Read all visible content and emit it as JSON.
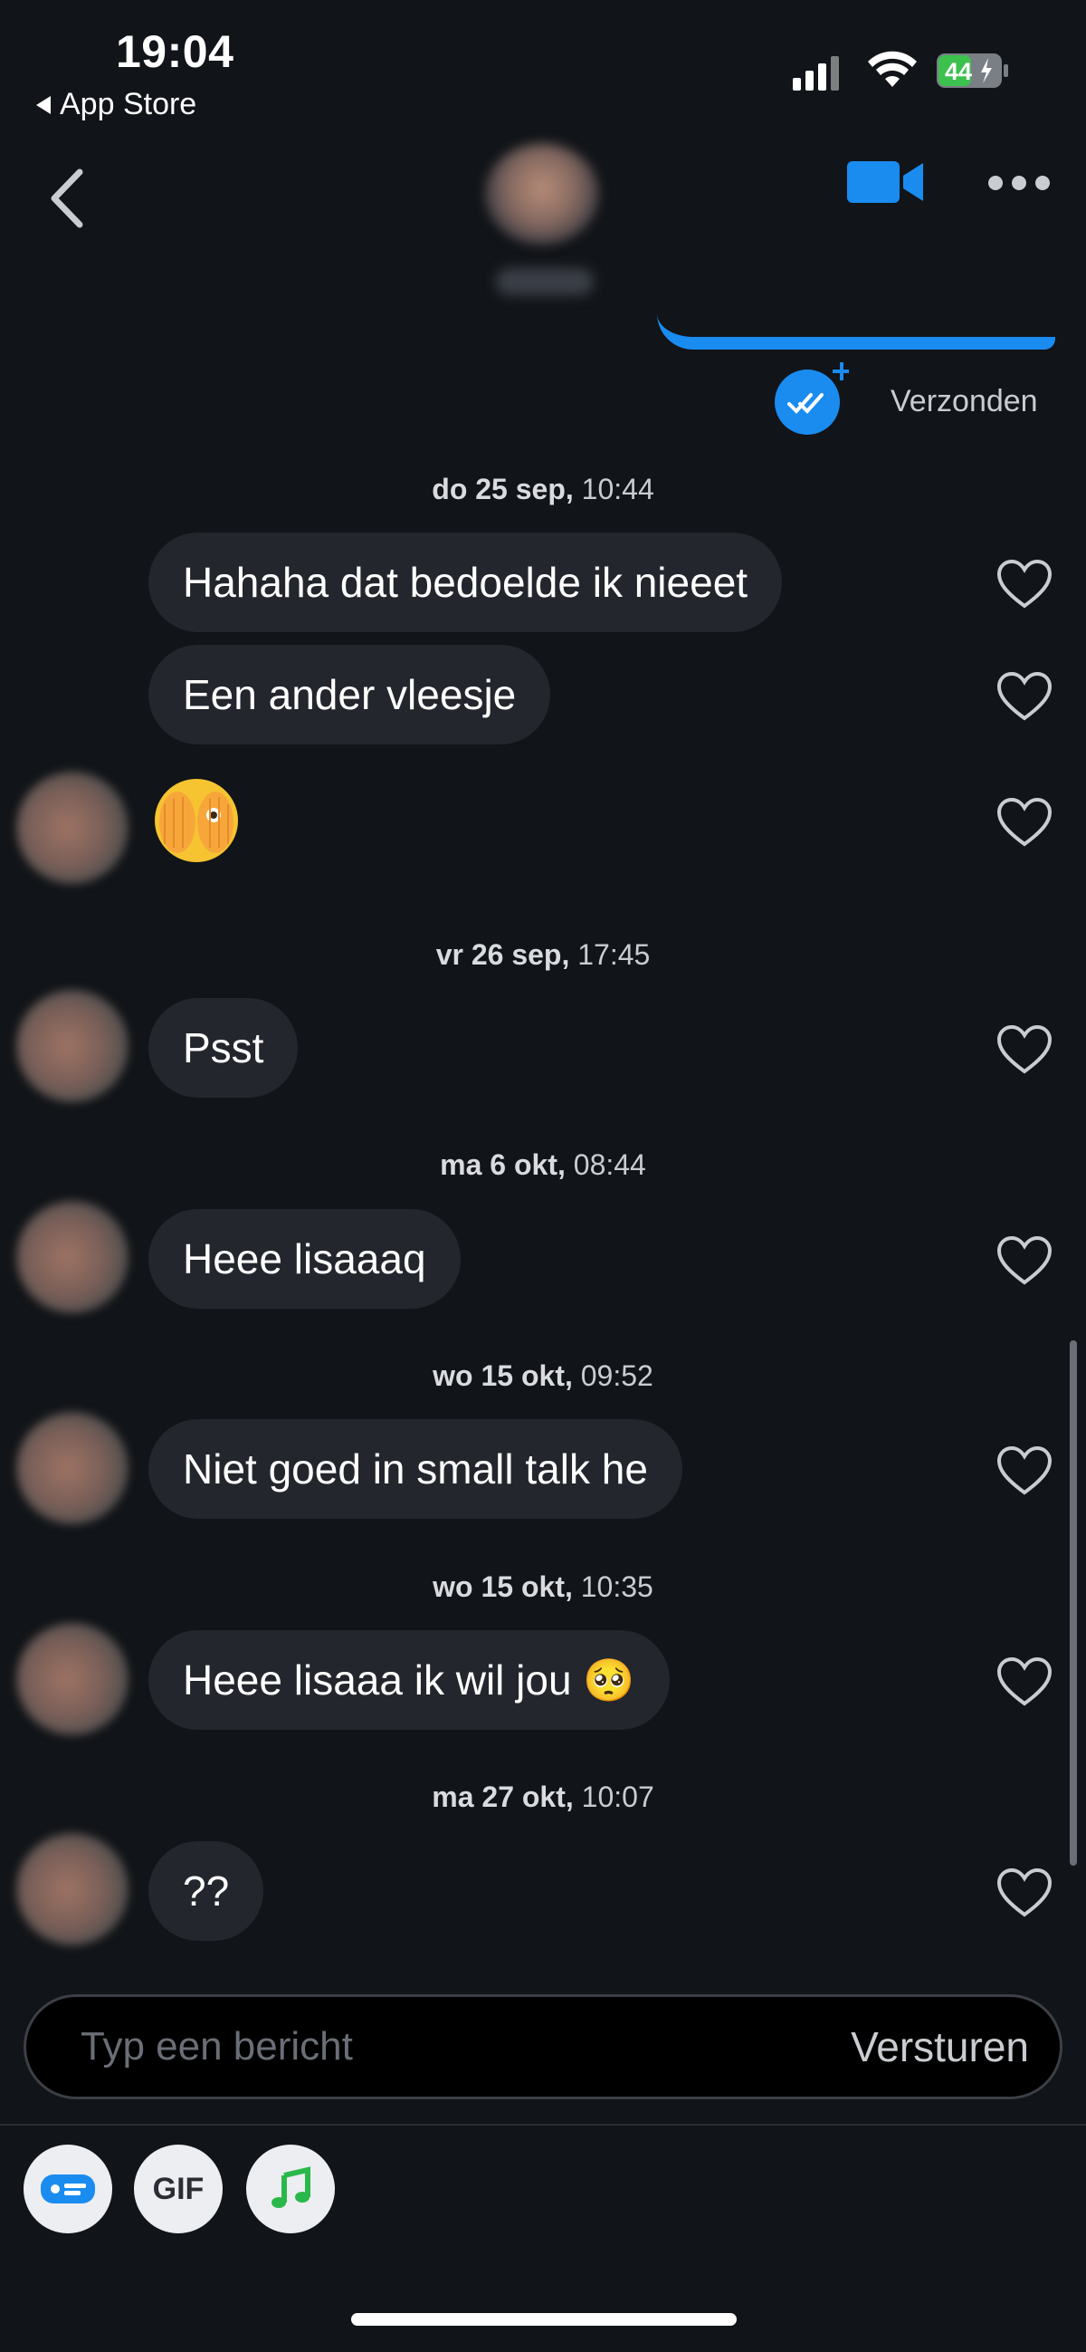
{
  "status_bar": {
    "time": "19:04",
    "back_app": "App Store",
    "battery": "44"
  },
  "header": {
    "back_icon": "chevron-left-icon",
    "video_icon": "video-camera-icon",
    "more_icon": "ellipsis-icon"
  },
  "sent_status": "Verzonden",
  "messages": [
    {
      "date_day": "do 25 sep,",
      "date_time": "10:44"
    },
    {
      "text": "Hahaha dat bedoelde ik nieeet"
    },
    {
      "text": "Een ander vleesje"
    },
    {
      "emoji": "🫣"
    },
    {
      "date_day": "vr 26 sep,",
      "date_time": "17:45"
    },
    {
      "text": "Psst"
    },
    {
      "date_day": "ma 6 okt,",
      "date_time": "08:44"
    },
    {
      "text": "Heee lisaaaq"
    },
    {
      "date_day": "wo 15 okt,",
      "date_time": "09:52"
    },
    {
      "text": "Niet goed in small talk he"
    },
    {
      "date_day": "wo 15 okt,",
      "date_time": "10:35"
    },
    {
      "text": "Heee lisaaa ik wil jou 🥺"
    },
    {
      "date_day": "ma 27 okt,",
      "date_time": "10:07"
    },
    {
      "text": "??"
    }
  ],
  "composer": {
    "placeholder": "Typ een bericht",
    "send_label": "Versturen"
  },
  "toolbar": {
    "gif_label": "GIF"
  },
  "colors": {
    "accent": "#1a8cf0",
    "bubble": "#23262d",
    "background": "#111418"
  }
}
